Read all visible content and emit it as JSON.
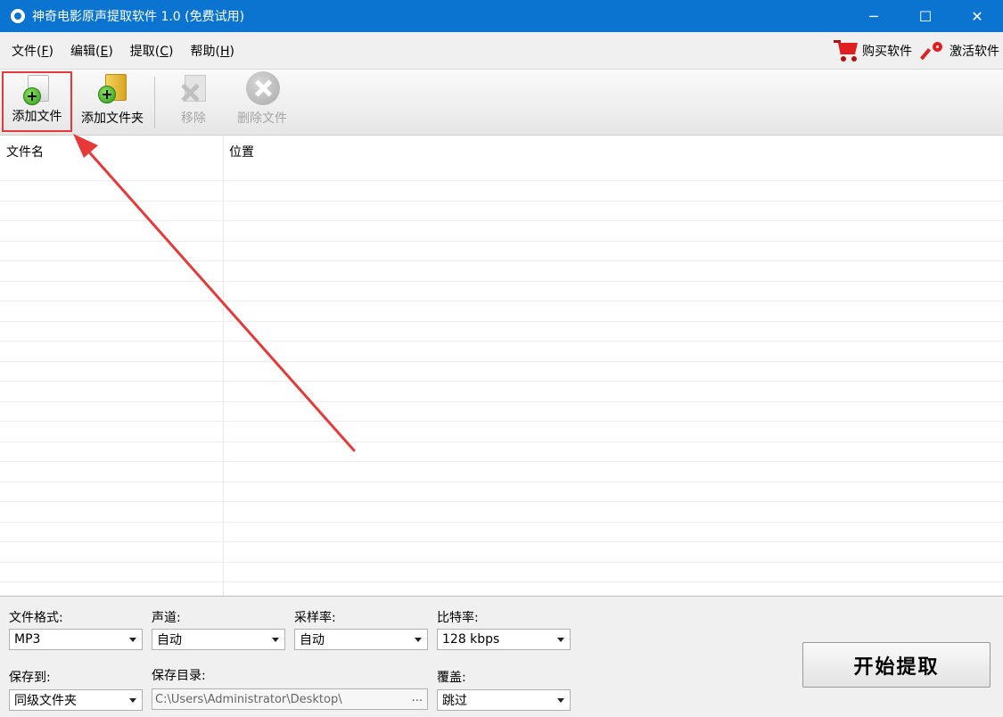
{
  "window": {
    "title": "神奇电影原声提取软件 1.0 (免费试用)",
    "controls": {
      "minimize": "─",
      "maximize": "☐",
      "close": "✕"
    }
  },
  "menu": {
    "items": [
      {
        "label": "文件(",
        "key": "F",
        "end": ")"
      },
      {
        "label": "编辑(",
        "key": "E",
        "end": ")"
      },
      {
        "label": "提取(",
        "key": "C",
        "end": ")"
      },
      {
        "label": "帮助(",
        "key": "H",
        "end": ")"
      }
    ],
    "buy_label": "购买软件",
    "activate_label": "激活软件"
  },
  "toolbar": {
    "add_file": "添加文件",
    "add_folder": "添加文件夹",
    "remove": "移除",
    "delete_file": "删除文件"
  },
  "list": {
    "columns": [
      "文件名",
      "位置"
    ],
    "rows": []
  },
  "settings": {
    "format": {
      "label": "文件格式:",
      "value": "MP3"
    },
    "channel": {
      "label": "声道:",
      "value": "自动"
    },
    "sample_rate": {
      "label": "采样率:",
      "value": "自动"
    },
    "bitrate": {
      "label": "比特率:",
      "value": "128 kbps"
    },
    "save_to": {
      "label": "保存到:",
      "value": "同级文件夹"
    },
    "save_dir": {
      "label": "保存目录:",
      "value": "C:\\Users\\Administrator\\Desktop\\",
      "browse": "..."
    },
    "overwrite": {
      "label": "覆盖:",
      "value": "跳过"
    },
    "start_label": "开始提取"
  },
  "colors": {
    "titlebar": "#0a74d0",
    "highlight": "#e8393a",
    "accent_red": "#e02020"
  }
}
